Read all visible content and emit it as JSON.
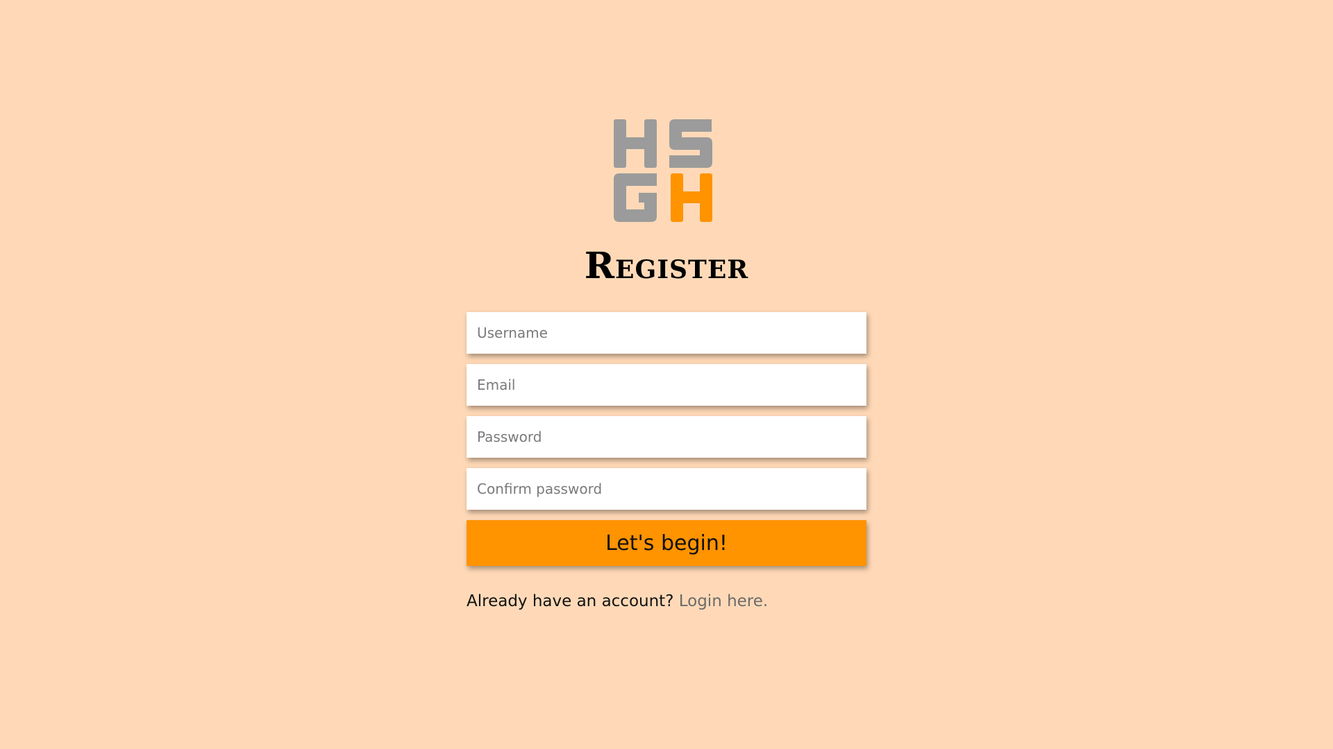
{
  "logo": {
    "letters": [
      "H",
      "S",
      "G",
      "H"
    ],
    "gray": "#9b9b9b",
    "orange": "#ff9300"
  },
  "title": "Register",
  "form": {
    "username_placeholder": "Username",
    "email_placeholder": "Email",
    "password_placeholder": "Password",
    "confirm_placeholder": "Confirm password",
    "submit_label": "Let's begin!"
  },
  "footer": {
    "prompt": "Already have an account?",
    "link_label": "Login here."
  },
  "colors": {
    "background": "#ffd9b7",
    "accent": "#ff9300",
    "link": "#6b6b6b"
  }
}
